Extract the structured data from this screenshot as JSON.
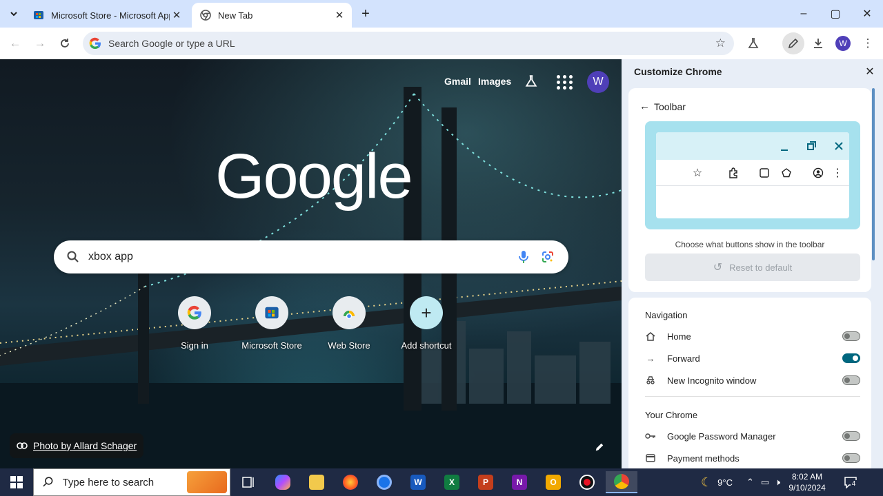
{
  "tabs": [
    {
      "title": "Microsoft Store - Microsoft App",
      "active": false
    },
    {
      "title": "New Tab",
      "active": true
    }
  ],
  "window": {
    "minimize": "–",
    "maximize": "▢",
    "close": "✕"
  },
  "omnibox": {
    "placeholder": "Search Google or type a URL"
  },
  "profile": {
    "initial": "W",
    "color": "#4f3fb8"
  },
  "ntp": {
    "links": {
      "gmail": "Gmail",
      "images": "Images"
    },
    "logo": "Google",
    "search": {
      "value": "xbox app"
    },
    "shortcuts": [
      {
        "label": "Sign in"
      },
      {
        "label": "Microsoft Store"
      },
      {
        "label": "Web Store"
      },
      {
        "label": "Add shortcut"
      }
    ],
    "photo_credit": "Photo by Allard Schager"
  },
  "panel": {
    "title": "Customize Chrome",
    "back_label": "Toolbar",
    "caption": "Choose what buttons show in the toolbar",
    "reset_label": "Reset to default",
    "sections": {
      "navigation": {
        "title": "Navigation",
        "items": [
          {
            "label": "Home",
            "on": false
          },
          {
            "label": "Forward",
            "on": true
          },
          {
            "label": "New Incognito window",
            "on": false
          }
        ]
      },
      "your_chrome": {
        "title": "Your Chrome",
        "items": [
          {
            "label": "Google Password Manager",
            "on": false
          },
          {
            "label": "Payment methods",
            "on": false
          }
        ]
      }
    }
  },
  "taskbar": {
    "search_placeholder": "Type here to search",
    "weather": "9°C",
    "time": "8:02 AM",
    "date": "9/10/2024",
    "notifications": "4"
  }
}
